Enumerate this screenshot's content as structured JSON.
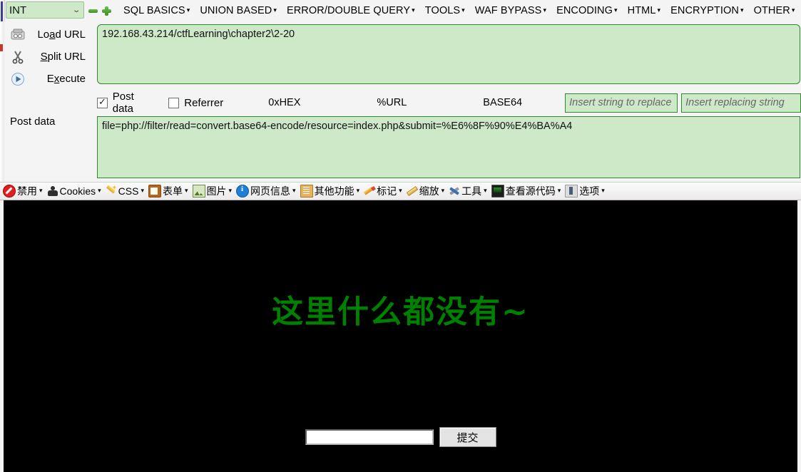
{
  "hackbar": {
    "sqli_type": {
      "value": "INT",
      "chevron_icon": "chevron-down-icon"
    },
    "minus_label": "",
    "plus_label": "",
    "menus": [
      {
        "label": "SQL BASICS",
        "caret": "▾"
      },
      {
        "label": "UNION BASED",
        "caret": "▾"
      },
      {
        "label": "ERROR/DOUBLE QUERY",
        "caret": "▾"
      },
      {
        "label": "TOOLS",
        "caret": "▾"
      },
      {
        "label": "WAF BYPASS",
        "caret": "▾"
      },
      {
        "label": "ENCODING",
        "caret": "▾"
      },
      {
        "label": "HTML",
        "caret": "▾"
      },
      {
        "label": "ENCRYPTION",
        "caret": "▾"
      },
      {
        "label": "OTHER",
        "caret": "▾"
      }
    ],
    "actions": [
      {
        "label_pre": "Lo",
        "label_accel": "a",
        "label_post": "d URL",
        "icon": "load-url-icon"
      },
      {
        "label_pre": "",
        "label_accel": "S",
        "label_post": "plit URL",
        "icon": "scissors-icon"
      },
      {
        "label_pre": "E",
        "label_accel": "x",
        "label_post": "ecute",
        "icon": "play-icon"
      }
    ],
    "post_data_label": "Post data",
    "url_value": "192.168.43.214/ctfLearning\\chapter2\\2-20",
    "post_data_value": "file=php://filter/read=convert.base64-encode/resource=index.php&submit=%E6%8F%90%E4%BA%A4",
    "options": {
      "post_data_checkbox": {
        "label": "Post data",
        "checked": true,
        "tick": "✓"
      },
      "referrer_checkbox": {
        "label": "Referrer",
        "checked": false,
        "tick": ""
      },
      "codecs": [
        {
          "name": "0xHEX"
        },
        {
          "name": "%URL"
        },
        {
          "name": "BASE64"
        }
      ],
      "replace_input_placeholder": "Insert string to replace",
      "replace_input_value": "",
      "replacing_input_placeholder": "Insert replacing string",
      "replacing_input_value": ""
    }
  },
  "devbar": {
    "items": [
      {
        "label": "禁用",
        "icon": "disable-icon",
        "caret": "▾"
      },
      {
        "label": "Cookies",
        "icon": "cookie-icon",
        "caret": "▾"
      },
      {
        "label": "CSS",
        "icon": "css-wand-icon",
        "caret": "▾"
      },
      {
        "label": "表单",
        "icon": "form-clipboard-icon",
        "caret": "▾"
      },
      {
        "label": "图片",
        "icon": "image-icon",
        "caret": "▾"
      },
      {
        "label": "网页信息",
        "icon": "info-icon",
        "caret": "▾"
      },
      {
        "label": "其他功能",
        "icon": "misc-icon",
        "caret": "▾"
      },
      {
        "label": "标记",
        "icon": "pencil-icon",
        "caret": "▾"
      },
      {
        "label": "缩放",
        "icon": "ruler-icon",
        "caret": "▾"
      },
      {
        "label": "工具",
        "icon": "tools-icon",
        "caret": "▾"
      },
      {
        "label": "查看源代码",
        "icon": "view-source-icon",
        "caret": "▾"
      },
      {
        "label": "选项",
        "icon": "options-icon",
        "caret": "▾"
      }
    ]
  },
  "page": {
    "message": "这里什么都没有~",
    "message_color": "#008000",
    "background_color": "#000000",
    "input_value": "",
    "submit_label": "提交"
  }
}
